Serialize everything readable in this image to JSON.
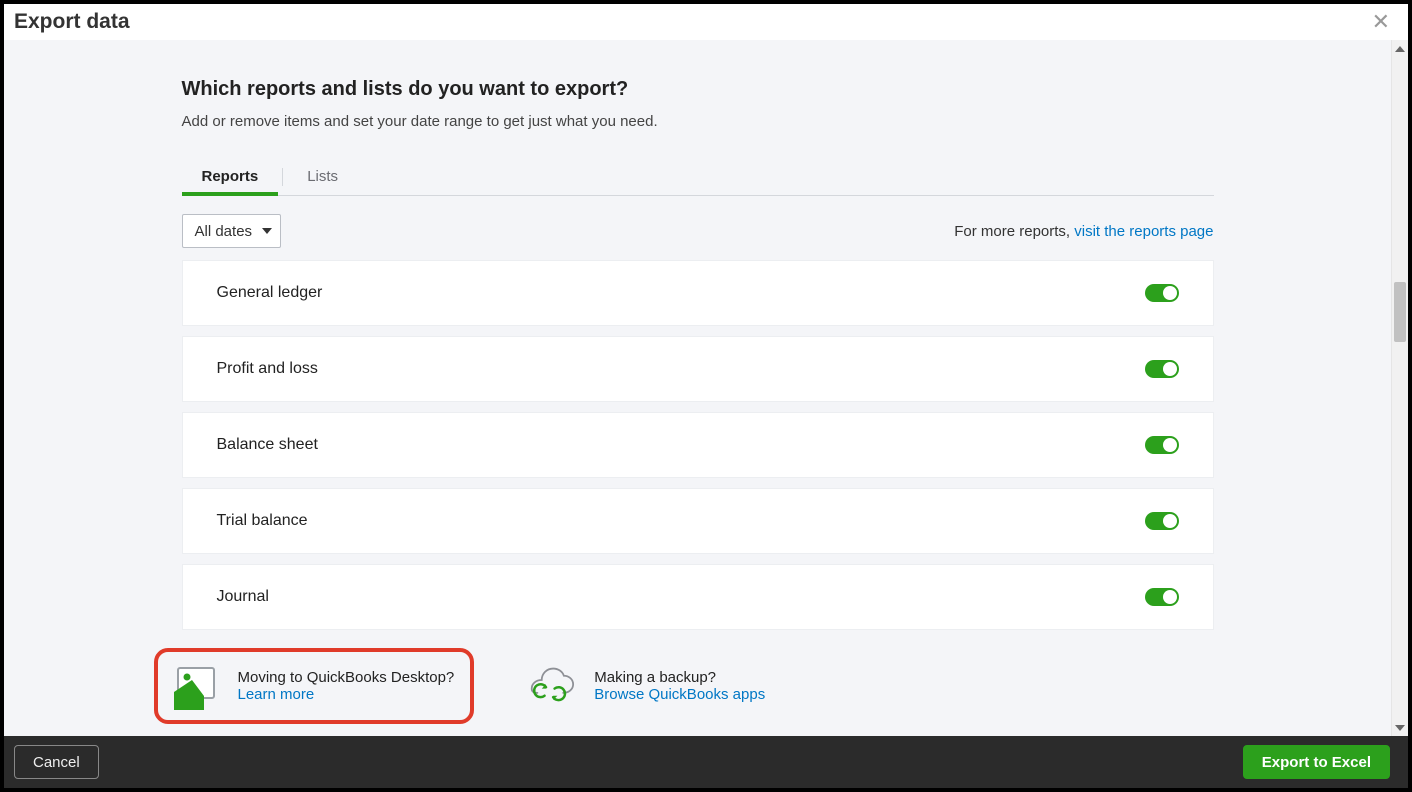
{
  "header": {
    "title": "Export data"
  },
  "main": {
    "heading": "Which reports and lists do you want to export?",
    "subheading": "Add or remove items and set your date range to get just what you need."
  },
  "tabs": [
    {
      "label": "Reports",
      "active": true
    },
    {
      "label": "Lists",
      "active": false
    }
  ],
  "filters": {
    "date_range": "All dates",
    "more_reports_prefix": "For more reports, ",
    "more_reports_link": "visit the reports page"
  },
  "reports": [
    {
      "name": "General ledger",
      "enabled": true
    },
    {
      "name": "Profit and loss",
      "enabled": true
    },
    {
      "name": "Balance sheet",
      "enabled": true
    },
    {
      "name": "Trial balance",
      "enabled": true
    },
    {
      "name": "Journal",
      "enabled": true
    }
  ],
  "cards": [
    {
      "title": "Moving to QuickBooks Desktop?",
      "link": "Learn more"
    },
    {
      "title": "Making a backup?",
      "link": "Browse QuickBooks apps"
    }
  ],
  "footer": {
    "cancel": "Cancel",
    "export": "Export to Excel"
  }
}
